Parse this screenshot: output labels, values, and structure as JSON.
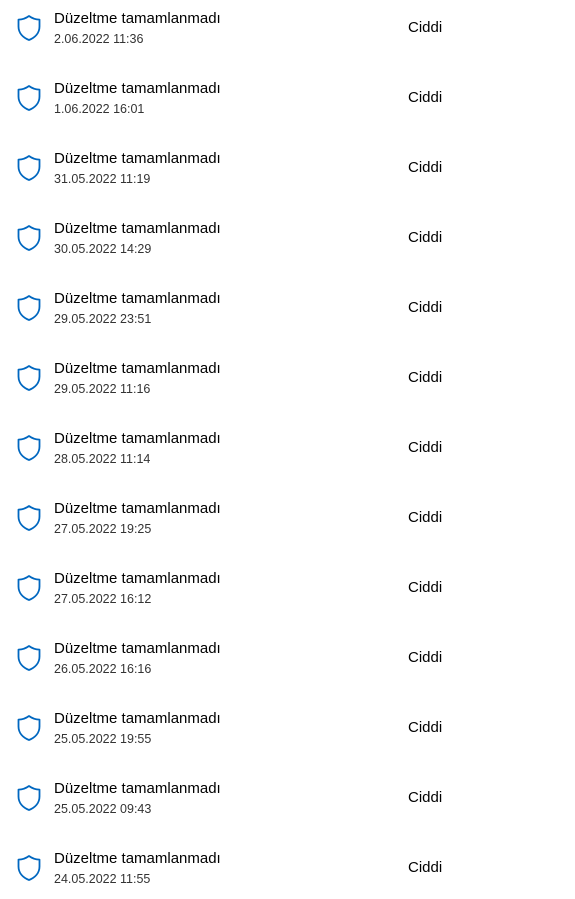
{
  "colors": {
    "accent": "#0067c0",
    "text": "#000000",
    "secondary_text": "#333333",
    "background": "#ffffff"
  },
  "icon": "shield-icon",
  "history": [
    {
      "title": "Düzeltme tamamlanmadı",
      "date": "2.06.2022 11:36",
      "severity": "Ciddi"
    },
    {
      "title": "Düzeltme tamamlanmadı",
      "date": "1.06.2022 16:01",
      "severity": "Ciddi"
    },
    {
      "title": "Düzeltme tamamlanmadı",
      "date": "31.05.2022 11:19",
      "severity": "Ciddi"
    },
    {
      "title": "Düzeltme tamamlanmadı",
      "date": "30.05.2022 14:29",
      "severity": "Ciddi"
    },
    {
      "title": "Düzeltme tamamlanmadı",
      "date": "29.05.2022 23:51",
      "severity": "Ciddi"
    },
    {
      "title": "Düzeltme tamamlanmadı",
      "date": "29.05.2022 11:16",
      "severity": "Ciddi"
    },
    {
      "title": "Düzeltme tamamlanmadı",
      "date": "28.05.2022 11:14",
      "severity": "Ciddi"
    },
    {
      "title": "Düzeltme tamamlanmadı",
      "date": "27.05.2022 19:25",
      "severity": "Ciddi"
    },
    {
      "title": "Düzeltme tamamlanmadı",
      "date": "27.05.2022 16:12",
      "severity": "Ciddi"
    },
    {
      "title": "Düzeltme tamamlanmadı",
      "date": "26.05.2022 16:16",
      "severity": "Ciddi"
    },
    {
      "title": "Düzeltme tamamlanmadı",
      "date": "25.05.2022 19:55",
      "severity": "Ciddi"
    },
    {
      "title": "Düzeltme tamamlanmadı",
      "date": "25.05.2022 09:43",
      "severity": "Ciddi"
    },
    {
      "title": "Düzeltme tamamlanmadı",
      "date": "24.05.2022 11:55",
      "severity": "Ciddi"
    }
  ]
}
